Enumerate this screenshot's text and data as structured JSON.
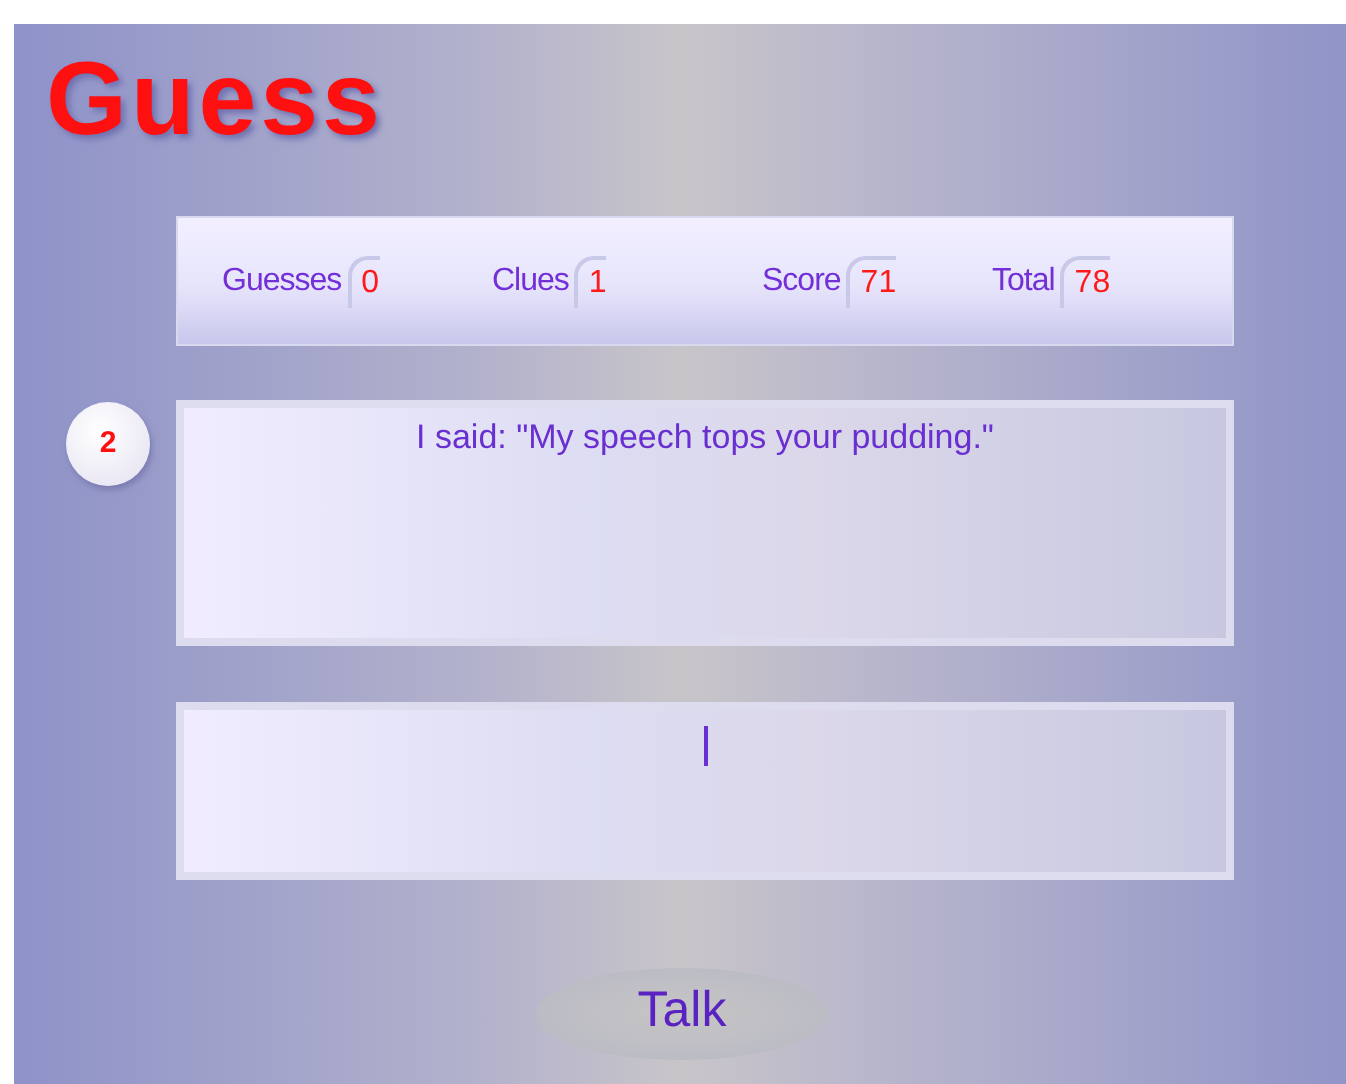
{
  "title": "Guess",
  "stats": [
    {
      "label": "Guesses",
      "value": "0"
    },
    {
      "label": "Clues",
      "value": "1"
    },
    {
      "label": "Score",
      "value": "71"
    },
    {
      "label": "Total",
      "value": "78"
    }
  ],
  "message": {
    "number": "2",
    "text": "I said: \"My speech tops your pudding.\""
  },
  "talk_button": "Talk"
}
